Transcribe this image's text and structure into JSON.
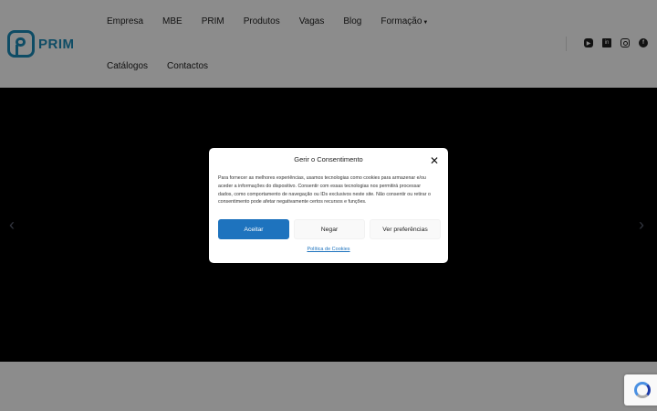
{
  "header": {
    "logo_text": "PRIM",
    "nav_row1": [
      "Empresa",
      "MBE",
      "PRIM",
      "Produtos",
      "Vagas",
      "Blog",
      "Formação"
    ],
    "nav_row2": [
      "Catálogos",
      "Contactos"
    ],
    "social_icons": [
      "youtube-icon",
      "linkedin-icon",
      "instagram-icon",
      "facebook-icon"
    ]
  },
  "hero": {
    "prev_arrow": "‹",
    "next_arrow": "›"
  },
  "consent": {
    "title": "Gerir o Consentimento",
    "close_glyph": "✕",
    "body": "Para fornecer as melhores experiências, usamos tecnologias como cookies para armazenar e/ou aceder a informações do dispositivo. Consentir com essas tecnologias nos permitirá processar dados, como comportamento de navegação ou IDs exclusivos neste site. Não consentir ou retirar o consentimento pode afetar negativamente certos recursos e funções.",
    "accept_label": "Aceitar",
    "deny_label": "Negar",
    "preferences_label": "Ver preferências",
    "cookie_policy_link": "Política de Cookies",
    "accent_color": "#1e73be"
  },
  "brand_color": "#1a8ab8"
}
